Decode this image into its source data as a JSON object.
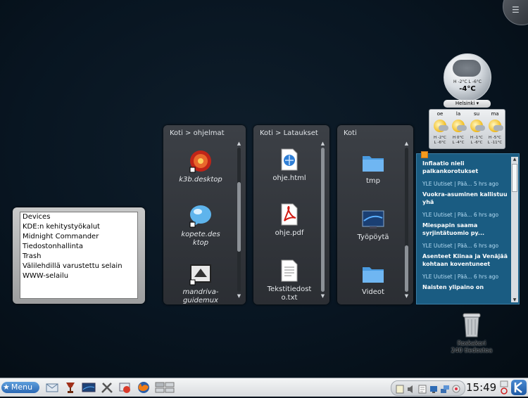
{
  "devices_widget": {
    "items": [
      "Devices",
      "KDE:n kehitystyökalut",
      "Midnight Commander",
      "Tiedostonhallinta",
      "Trash",
      "Välilehdillä varustettu selain",
      "WWW-selailu"
    ]
  },
  "folder_views": [
    {
      "title": "Koti > ohjelmat",
      "items": [
        {
          "label": "k3b.desktop",
          "icon": "k3b-icon"
        },
        {
          "label": "kopete.desktop",
          "icon": "kopete-icon"
        },
        {
          "label": "mandriva-guidemux",
          "icon": "mandriva-icon"
        }
      ],
      "scroll_fraction": 0.3
    },
    {
      "title": "Koti > Lataukset",
      "items": [
        {
          "label": "ohje.html",
          "icon": "html-file-icon"
        },
        {
          "label": "ohje.pdf",
          "icon": "pdf-file-icon"
        },
        {
          "label": "Tekstitiedosto.txt",
          "icon": "text-file-icon"
        }
      ],
      "scroll_fraction": 0.0
    },
    {
      "title": "Koti",
      "items": [
        {
          "label": "tmp",
          "icon": "folder-icon"
        },
        {
          "label": "Työpöytä",
          "icon": "desktop-folder-icon"
        },
        {
          "label": "Videot",
          "icon": "folder-icon"
        }
      ],
      "scroll_fraction": 0.75
    }
  ],
  "weather": {
    "city": "Helsinki",
    "current_temp": "-4°C",
    "current_hilo": "H -2°C  L -6°C",
    "forecast": [
      {
        "day": "oe",
        "high": "H -2°C",
        "low": "L -6°C"
      },
      {
        "day": "la",
        "high": "H 0°C",
        "low": "L -4°C"
      },
      {
        "day": "su",
        "high": "H -1°C",
        "low": "L -6°C"
      },
      {
        "day": "ma",
        "high": "H -5°C",
        "low": "L -11°C"
      }
    ]
  },
  "news": {
    "items": [
      {
        "headline": "Inflaatio nieli palkankorotukset",
        "meta": "YLE Uutiset | Pää... 5 hrs ago"
      },
      {
        "headline": "Vuokra-asuminen kallistuu yhä",
        "meta": "YLE Uutiset | Pää... 6 hrs ago"
      },
      {
        "headline": "Miespapin saama syrjintätuomio py...",
        "meta": "YLE Uutiset | Pää... 6 hrs ago"
      },
      {
        "headline": "Asenteet Kiinaa ja Venäjää kohtaan koventuneet",
        "meta": "YLE Uutiset | Pää... 6 hrs ago"
      },
      {
        "headline": "Naisten ylipaino on",
        "meta": ""
      }
    ]
  },
  "trash": {
    "name": "Roskakori",
    "count": "240 tiedostoa"
  },
  "taskbar": {
    "menu_label": "Menu",
    "clock": "15:49"
  },
  "colors": {
    "desktop": "#081521",
    "news_bg": "#1a5c82",
    "menu_button": "#2a67b3"
  }
}
